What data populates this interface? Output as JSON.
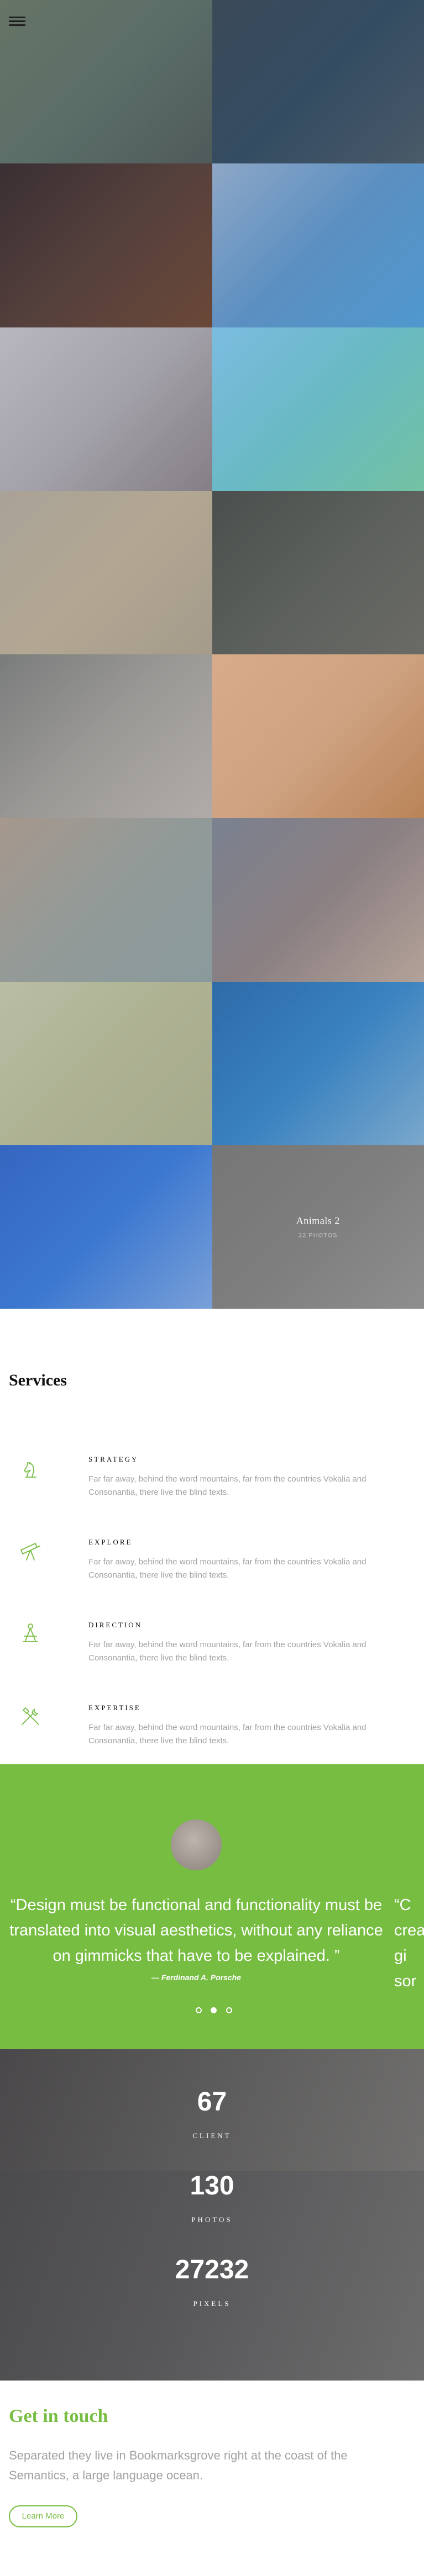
{
  "nav": {
    "menu_icon": "hamburger-menu-icon"
  },
  "gallery": {
    "tiles": [
      {
        "gradient": [
          "#667466",
          "#5b6e68",
          "#4f5a5a"
        ]
      },
      {
        "gradient": [
          "#3b4a58",
          "#344c62",
          "#4a5a68"
        ]
      },
      {
        "gradient": [
          "#3a2f33",
          "#55403c",
          "#6b4838"
        ]
      },
      {
        "gradient": [
          "#8ea7c6",
          "#5b8fc1",
          "#4f98ce"
        ]
      },
      {
        "gradient": [
          "#b8b6bf",
          "#a3a1a9",
          "#857e86"
        ]
      },
      {
        "gradient": [
          "#7bbce0",
          "#69b9c4",
          "#72c2a2"
        ]
      },
      {
        "gradient": [
          "#a9a297",
          "#b2a792",
          "#a59b8b"
        ]
      },
      {
        "gradient": [
          "#4a4f4d",
          "#5c605c",
          "#6a6a66"
        ]
      },
      {
        "gradient": [
          "#7a7c7c",
          "#9b9996",
          "#b0aba8"
        ]
      },
      {
        "gradient": [
          "#d8ab8a",
          "#cfa382",
          "#ba8458"
        ]
      },
      {
        "gradient": [
          "#a6988d",
          "#929a98",
          "#8a9a9c"
        ]
      },
      {
        "gradient": [
          "#7a8190",
          "#8a7f82",
          "#b3a298"
        ]
      },
      {
        "gradient": [
          "#b9bda3",
          "#aeb293",
          "#a6aa8c"
        ]
      },
      {
        "gradient": [
          "#2e6aa8",
          "#3a82c0",
          "#7aa8cc"
        ]
      },
      {
        "gradient": [
          "#3566c0",
          "#3c78d0",
          "#7aa0d8"
        ]
      },
      {
        "gradient": [
          "#767676",
          "#7e7e7e",
          "#8e8e8e"
        ],
        "caption": {
          "title": "Animals 2",
          "count": "22 PHOTOS"
        }
      }
    ]
  },
  "services": {
    "title": "Services",
    "items": [
      {
        "icon": "chess-knight-icon",
        "title": "STRATEGY",
        "text": "Far far away, behind the word mountains, far from the countries Vokalia and Consonantia, there live the blind texts."
      },
      {
        "icon": "telescope-icon",
        "title": "EXPLORE",
        "text": "Far far away, behind the word mountains, far from the countries Vokalia and Consonantia, there live the blind texts."
      },
      {
        "icon": "compass-icon",
        "title": "DIRECTION",
        "text": "Far far away, behind the word mountains, far from the countries Vokalia and Consonantia, there live the blind texts."
      },
      {
        "icon": "tools-icon",
        "title": "EXPERTISE",
        "text": "Far far away, behind the word mountains, far from the countries Vokalia and Consonantia, there live the blind texts."
      }
    ]
  },
  "testimonial": {
    "quote": "“Design must be functional and functionality must be translated into visual aesthetics, without any reliance on gimmicks that have to be explained. ”",
    "author": "— Ferdinand A. Porsche",
    "next_peek": "“C\ncrea\ngi\nsor",
    "slide_count": 3,
    "active_slide": 1
  },
  "stats": [
    {
      "value": "67",
      "label": "CLIENT"
    },
    {
      "value": "130",
      "label": "PHOTOS"
    },
    {
      "value": "27232",
      "label": "PIXELS"
    }
  ],
  "contact": {
    "title": "Get in touch",
    "text": "Separated they live in Bookmarksgrove right at the coast of the Semantics, a large language ocean.",
    "button": "Learn More"
  },
  "colors": {
    "accent": "#77bd42",
    "text_muted": "#a2a2a2",
    "heading": "#111111"
  }
}
